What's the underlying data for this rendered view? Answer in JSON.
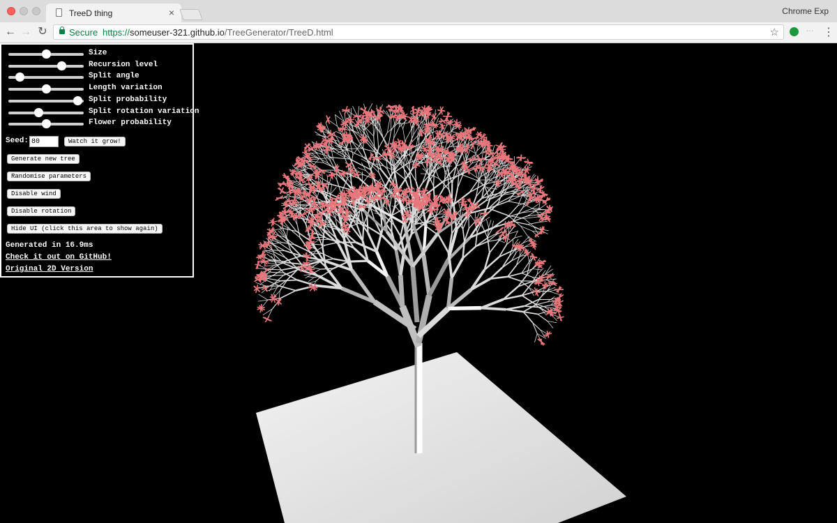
{
  "browser": {
    "tab_title": "TreeD thing",
    "tab_close": "×",
    "profile_label": "Chrome Exp",
    "secure_label": "Secure",
    "url_scheme": "https://",
    "url_host": "someuser-321.github.io",
    "url_path": "/TreeGenerator/TreeD.html",
    "back_icon": "←",
    "forward_icon": "→",
    "reload_icon": "↻",
    "star_icon": "☆",
    "menu_icon": "⋮",
    "ext_label": "⋅⋅⋅"
  },
  "controls": {
    "sliders": [
      {
        "label": "Size",
        "value": 0.5
      },
      {
        "label": "Recursion level",
        "value": 0.7
      },
      {
        "label": "Split angle",
        "value": 0.15
      },
      {
        "label": "Length variation",
        "value": 0.5
      },
      {
        "label": "Split probability",
        "value": 0.92
      },
      {
        "label": "Split rotation variation",
        "value": 0.4
      },
      {
        "label": "Flower probability",
        "value": 0.5
      }
    ],
    "seed_label": "Seed:",
    "seed_value": "80",
    "buttons": {
      "watch": "Watch it grow!",
      "generate": "Generate new tree",
      "randomise": "Randomise parameters",
      "wind": "Disable wind",
      "rotation": "Disable rotation",
      "hide": "Hide UI (click this area to show again)"
    },
    "status": "Generated in 16.9ms",
    "link_github": "Check it out on GitHub!",
    "link_2d": "Original 2D Version"
  },
  "scene": {
    "ground_color": "#e8e8e8",
    "branch_color": "#ffffff",
    "flower_color": "#e8777c",
    "background": "#000000"
  }
}
